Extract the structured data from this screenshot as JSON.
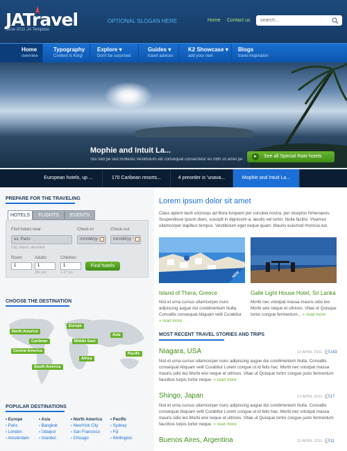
{
  "header": {
    "logo": "JATravel",
    "logo_tagline": "June 2011 JA Template",
    "slogan": "OPTIONAL SLOGAN HERE",
    "links": [
      "Home",
      "Contact us"
    ],
    "search_placeholder": "search..."
  },
  "nav": [
    {
      "title": "Home",
      "sub": "overview"
    },
    {
      "title": "Typography",
      "sub": "Content is King!"
    },
    {
      "title": "Explore",
      "sub": "Don't be surprised"
    },
    {
      "title": "Guides",
      "sub": "travel advices"
    },
    {
      "title": "K2 Showcase",
      "sub": "add your own"
    },
    {
      "title": "Blogs",
      "sub": "travel inspiration"
    }
  ],
  "hero": {
    "caption": "Mophie and Intuit La...",
    "description": "Sisi sed pe sed mollestu Vestibulum elit consequat consectetur eu nibh sit amet per senec...",
    "button": "See all Special Rate hotels",
    "thumbs": [
      "European hotels, up ...",
      "170 Caribean resorts...",
      "4 preorder is 'unava...",
      "Mophie and Intuit La..."
    ]
  },
  "prepare": {
    "title": "PREPARE FOR THE TRAVELING",
    "tabs": [
      "HOTELS",
      "FLIGHTS",
      "EVENTS"
    ],
    "find_label": "Find hotels near",
    "find_value": "ex. Paris",
    "find_hint": "City, airport, attraction",
    "checkin_label": "Check-in:",
    "checkout_label": "Check-out",
    "date_placeholder": "mm/dd/yy",
    "room_label": "Room",
    "adults_label": "Adults:",
    "children_label": "Children:",
    "room_value": "1",
    "adults_value": "1",
    "children_value": "1",
    "adults_hint": "18+ yrs",
    "children_hint": "1-17 yrs",
    "button": "Find hotels"
  },
  "destination": {
    "title": "CHOOSE THE DESTINATION",
    "pins": [
      "North America",
      "Europe",
      "Caribean",
      "Middle East",
      "Asia",
      "Central America",
      "Africa",
      "Pacific",
      "South America"
    ]
  },
  "popular": {
    "title": "POPULAR DESTINATIONS",
    "columns": [
      {
        "head": "Europe",
        "items": [
          "Paris",
          "London",
          "Amsterdam"
        ]
      },
      {
        "head": "Asia",
        "items": [
          "Bangkok",
          "Udaipur",
          "Istanbul"
        ]
      },
      {
        "head": "North America",
        "items": [
          "NewYork City",
          "San Francisco",
          "Chicago"
        ]
      },
      {
        "head": "Pacific",
        "items": [
          "Sydney",
          "Fiji",
          "Wellington"
        ]
      }
    ]
  },
  "main": {
    "title": "Lorem ipsum dolor sit amet",
    "intro": "Class aptent taciti sociosqu ad litora torquent per conubia nostra, per inceptos himenaeos. Suspendisse ipsum diam, suscipit in dignissim a, iaculis vel tortor. Nulla facilisi. Vivamus ullamcorper dapibus tempus. Vestibulum eget neque quam. Mauris euismod rhoncus est.",
    "photos": [
      {
        "title": "Island of Thera, Greece",
        "text": "Nisl et urna cursus ullamcorper nunc adipiscing augue dui condimentum Nulla. Convallis consequat Aliquam velit Curabitur",
        "more": "read more"
      },
      {
        "title": "Galle Light House Hotel, Sri Lanka",
        "text": "Morbi nec volutpat massa mauris odio leo Morbi wisi neque et ultrices. Vitae ut Quisque tortor congue fermentum...",
        "more": "read more"
      }
    ],
    "photo_badge": "NEW",
    "stories_title": "MOST RECENT TRAVEL STORIES AND TRIPS",
    "stories": [
      {
        "title": "Niagara, USA",
        "date": "13 APRIL 2011",
        "comments": "143",
        "text": "Nisl et urna cursus ullamcorper nunc adipiscing augue dui condimentum Nulla. Convallis consequat Aliquam velit Curabitur Lorem congue ut id felis hac. Morbi nec volutpat massa mauris odio leo Morbi wisi neque et ultrices. Vitae ut Quisque tortor congue justo fermentum faucibus turpis tortor neque.",
        "more": "read more"
      },
      {
        "title": "Shingo, Japan",
        "date": "13 APRIL 2011",
        "comments": "17",
        "text": "Nisl et urna cursus ullamcorper nunc adipiscing augue dui condimentum Nulla. Convallis consequat Aliquam velit Curabitur Lorem congue ut id felis hac. Morbi nec volutpat massa mauris odio leo Morbi wisi neque et ultrices. Vitae ut Quisque tortor congue justo fermentum faucibus turpis tortor neque.",
        "more": "read more"
      },
      {
        "title": "Buenos Aires, Argentina",
        "date": "13 APRIL 2011",
        "comments": "11",
        "text": "",
        "more": ""
      }
    ]
  },
  "colors": {
    "brand_blue": "#1c6fd6",
    "accent_green": "#6ab32a",
    "header_dark": "#163a64"
  }
}
